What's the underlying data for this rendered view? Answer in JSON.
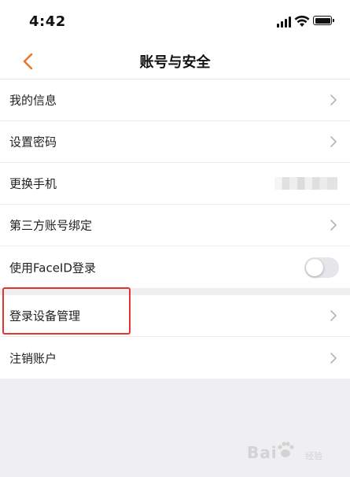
{
  "status_bar": {
    "time": "4:42"
  },
  "nav": {
    "title": "账号与安全",
    "back_icon": "chevron-left-icon",
    "accent_color": "#e8772e"
  },
  "group1": [
    {
      "label": "我的信息",
      "trailing": "chevron"
    },
    {
      "label": "设置密码",
      "trailing": "chevron"
    },
    {
      "label": "更换手机",
      "trailing": "blurred-phone"
    },
    {
      "label": "第三方账号绑定",
      "trailing": "chevron"
    },
    {
      "label": "使用FaceID登录",
      "trailing": "toggle",
      "toggle_on": false
    }
  ],
  "group2": [
    {
      "label": "登录设备管理",
      "trailing": "chevron",
      "highlighted": true
    },
    {
      "label": "注销账户",
      "trailing": "chevron"
    }
  ],
  "highlight_color": "#e3342f",
  "watermark": {
    "text": "Bai",
    "subtext": "经验"
  }
}
